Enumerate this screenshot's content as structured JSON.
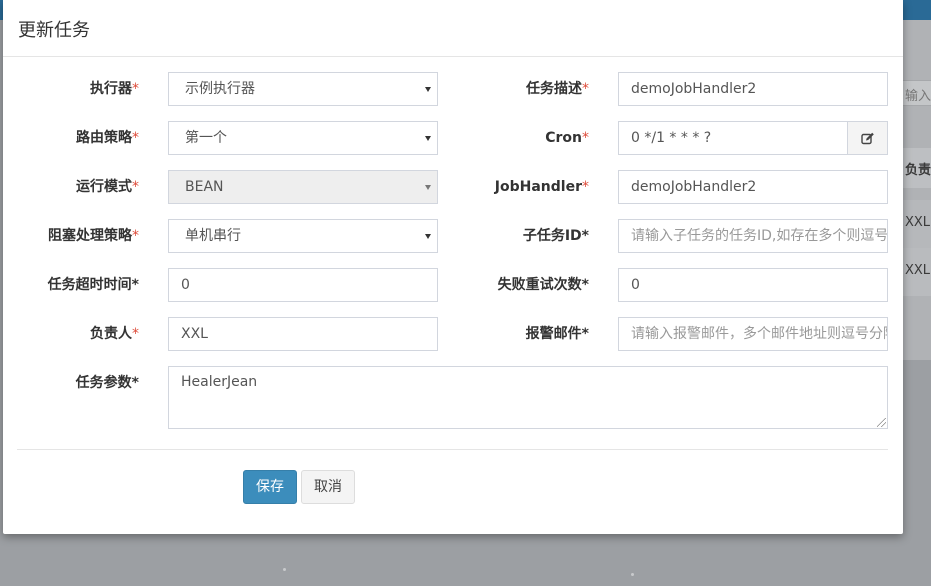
{
  "dialog": {
    "title": "更新任务"
  },
  "form": {
    "executor": {
      "label": "执行器",
      "required_mark": "*",
      "value": "示例执行器"
    },
    "task_desc": {
      "label": "任务描述",
      "required_mark": "*",
      "value": "demoJobHandler2"
    },
    "route_strategy": {
      "label": "路由策略",
      "required_mark": "*",
      "value": "第一个"
    },
    "cron": {
      "label": "Cron",
      "required_mark": "*",
      "value": "0 */1 * * * ?"
    },
    "run_mode": {
      "label": "运行模式",
      "required_mark": "*",
      "value": "BEAN"
    },
    "job_handler": {
      "label": "JobHandler",
      "required_mark": "*",
      "value": "demoJobHandler2"
    },
    "block_strategy": {
      "label": "阻塞处理策略",
      "required_mark": "*",
      "value": "单机串行"
    },
    "child_job_id": {
      "label": "子任务ID*",
      "placeholder": "请输入子任务的任务ID,如存在多个则逗号分隔"
    },
    "timeout": {
      "label": "任务超时时间*",
      "value": "0"
    },
    "retry_count": {
      "label": "失败重试次数*",
      "value": "0"
    },
    "owner": {
      "label": "负责人",
      "required_mark": "*",
      "value": "XXL"
    },
    "alarm_email": {
      "label": "报警邮件*",
      "placeholder": "请输入报警邮件，多个邮件地址则逗号分隔"
    },
    "params": {
      "label": "任务参数*",
      "value": "HealerJean"
    }
  },
  "buttons": {
    "save": "保存",
    "cancel": "取消"
  },
  "background": {
    "search_placeholder_fragment": "输入负",
    "column_header_fragment": "负责",
    "row1_owner": "XXL",
    "row2_owner": "XXL"
  }
}
